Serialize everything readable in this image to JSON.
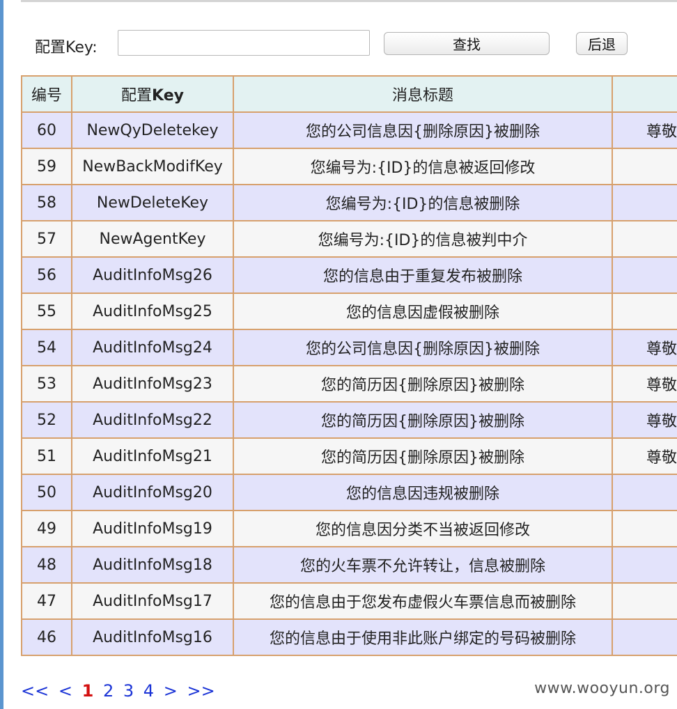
{
  "search": {
    "label": "配置Key:",
    "value": "",
    "search_button": "查找",
    "back_button": "后退"
  },
  "table": {
    "headers": [
      "编号",
      "配置",
      "Key",
      "消息标题",
      ""
    ],
    "rows": [
      {
        "id": "60",
        "key": "NewQyDeletekey",
        "title": "您的公司信息因{删除原因}被删除",
        "extra": "尊敬"
      },
      {
        "id": "59",
        "key": "NewBackModifKey",
        "title": "您编号为:{ID}的信息被返回修改",
        "extra": ""
      },
      {
        "id": "58",
        "key": "NewDeleteKey",
        "title": "您编号为:{ID}的信息被删除",
        "extra": ""
      },
      {
        "id": "57",
        "key": "NewAgentKey",
        "title": "您编号为:{ID}的信息被判中介",
        "extra": ""
      },
      {
        "id": "56",
        "key": "AuditInfoMsg26",
        "title": "您的信息由于重复发布被删除",
        "extra": ""
      },
      {
        "id": "55",
        "key": "AuditInfoMsg25",
        "title": "您的信息因虚假被删除",
        "extra": ""
      },
      {
        "id": "54",
        "key": "AuditInfoMsg24",
        "title": "您的公司信息因{删除原因}被删除",
        "extra": "尊敬"
      },
      {
        "id": "53",
        "key": "AuditInfoMsg23",
        "title": "您的简历因{删除原因}被删除",
        "extra": "尊敬"
      },
      {
        "id": "52",
        "key": "AuditInfoMsg22",
        "title": "您的简历因{删除原因}被删除",
        "extra": "尊敬"
      },
      {
        "id": "51",
        "key": "AuditInfoMsg21",
        "title": "您的简历因{删除原因}被删除",
        "extra": "尊敬"
      },
      {
        "id": "50",
        "key": "AuditInfoMsg20",
        "title": "您的信息因违规被删除",
        "extra": ""
      },
      {
        "id": "49",
        "key": "AuditInfoMsg19",
        "title": "您的信息因分类不当被返回修改",
        "extra": ""
      },
      {
        "id": "48",
        "key": "AuditInfoMsg18",
        "title": "您的火车票不允许转让，信息被删除",
        "extra": ""
      },
      {
        "id": "47",
        "key": "AuditInfoMsg17",
        "title": "您的信息由于您发布虚假火车票信息而被删除",
        "extra": ""
      },
      {
        "id": "46",
        "key": "AuditInfoMsg16",
        "title": "您的信息由于使用非此账户绑定的号码被删除",
        "extra": ""
      }
    ]
  },
  "pager": {
    "first": "<<",
    "prev": "<",
    "pages": [
      "1",
      "2",
      "3",
      "4"
    ],
    "current_page": "1",
    "next": ">",
    "last": ">>"
  },
  "watermark": "www.wooyun.org"
}
